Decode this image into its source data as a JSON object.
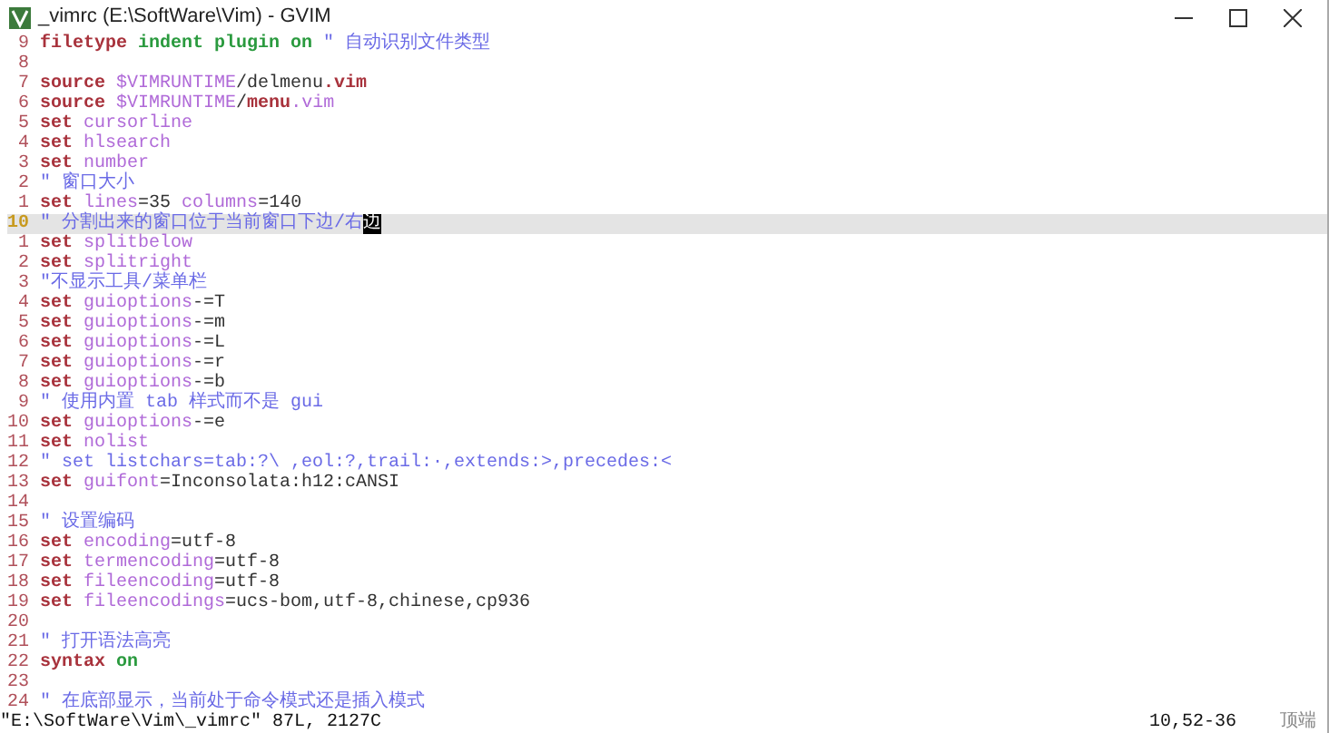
{
  "window": {
    "title": "_vimrc (E:\\SoftWare\\Vim) - GVIM"
  },
  "lines": [
    {
      "number": "9",
      "current": false,
      "tokens": [
        {
          "text": "filetype",
          "kind": "keyword"
        },
        {
          "text": " indent plugin on",
          "kind": "constant"
        },
        {
          "text": " \" 自动识别文件类型",
          "kind": "comment"
        }
      ]
    },
    {
      "number": "8",
      "current": false
    },
    {
      "number": "7",
      "current": false,
      "tokens": [
        {
          "text": "source",
          "kind": "keyword"
        },
        {
          "text": " $VIMRUNTIME",
          "kind": "option"
        },
        {
          "text": "/delmenu",
          "kind": "plain"
        },
        {
          "text": ".vim",
          "kind": "keyword"
        }
      ]
    },
    {
      "number": "6",
      "current": false,
      "tokens": [
        {
          "text": "source",
          "kind": "keyword"
        },
        {
          "text": " $VIMRUNTIME",
          "kind": "option"
        },
        {
          "text": "/",
          "kind": "plain"
        },
        {
          "text": "menu",
          "kind": "keyword"
        },
        {
          "text": ".vim",
          "kind": "option"
        }
      ]
    },
    {
      "number": "5",
      "current": false,
      "tokens": [
        {
          "text": "set",
          "kind": "keyword"
        },
        {
          "text": " cursorline",
          "kind": "option"
        }
      ]
    },
    {
      "number": "4",
      "current": false,
      "tokens": [
        {
          "text": "set",
          "kind": "keyword"
        },
        {
          "text": " hlsearch",
          "kind": "option"
        }
      ]
    },
    {
      "number": "3",
      "current": false,
      "tokens": [
        {
          "text": "set",
          "kind": "keyword"
        },
        {
          "text": " number",
          "kind": "option"
        }
      ]
    },
    {
      "number": "2",
      "current": false,
      "tokens": [
        {
          "text": "\" 窗口大小",
          "kind": "comment"
        }
      ]
    },
    {
      "number": "1",
      "current": false,
      "tokens": [
        {
          "text": "set",
          "kind": "keyword"
        },
        {
          "text": " lines",
          "kind": "option"
        },
        {
          "text": "=35",
          "kind": "plain"
        },
        {
          "text": " columns",
          "kind": "option"
        },
        {
          "text": "=140",
          "kind": "plain"
        }
      ]
    },
    {
      "number": "10",
      "current": true,
      "tokens": [
        {
          "text": "\" 分割出来的窗口位于当前窗口下边/右",
          "kind": "comment"
        },
        {
          "text": "边",
          "kind": "cursor"
        }
      ]
    },
    {
      "number": "1",
      "current": false,
      "tokens": [
        {
          "text": "set",
          "kind": "keyword"
        },
        {
          "text": " splitbelow",
          "kind": "option"
        }
      ]
    },
    {
      "number": "2",
      "current": false,
      "tokens": [
        {
          "text": "set",
          "kind": "keyword"
        },
        {
          "text": " splitright",
          "kind": "option"
        }
      ]
    },
    {
      "number": "3",
      "current": false,
      "tokens": [
        {
          "text": "\"不显示工具/菜单栏",
          "kind": "comment"
        }
      ]
    },
    {
      "number": "4",
      "current": false,
      "tokens": [
        {
          "text": "set",
          "kind": "keyword"
        },
        {
          "text": " guioptions",
          "kind": "option"
        },
        {
          "text": "-=T",
          "kind": "plain"
        }
      ]
    },
    {
      "number": "5",
      "current": false,
      "tokens": [
        {
          "text": "set",
          "kind": "keyword"
        },
        {
          "text": " guioptions",
          "kind": "option"
        },
        {
          "text": "-=m",
          "kind": "plain"
        }
      ]
    },
    {
      "number": "6",
      "current": false,
      "tokens": [
        {
          "text": "set",
          "kind": "keyword"
        },
        {
          "text": " guioptions",
          "kind": "option"
        },
        {
          "text": "-=L",
          "kind": "plain"
        }
      ]
    },
    {
      "number": "7",
      "current": false,
      "tokens": [
        {
          "text": "set",
          "kind": "keyword"
        },
        {
          "text": " guioptions",
          "kind": "option"
        },
        {
          "text": "-=r",
          "kind": "plain"
        }
      ]
    },
    {
      "number": "8",
      "current": false,
      "tokens": [
        {
          "text": "set",
          "kind": "keyword"
        },
        {
          "text": " guioptions",
          "kind": "option"
        },
        {
          "text": "-=b",
          "kind": "plain"
        }
      ]
    },
    {
      "number": "9",
      "current": false,
      "tokens": [
        {
          "text": "\" 使用内置 tab 样式而不是 gui",
          "kind": "comment"
        }
      ]
    },
    {
      "number": "10",
      "current": false,
      "tokens": [
        {
          "text": "set",
          "kind": "keyword"
        },
        {
          "text": " guioptions",
          "kind": "option"
        },
        {
          "text": "-=e",
          "kind": "plain"
        }
      ]
    },
    {
      "number": "11",
      "current": false,
      "tokens": [
        {
          "text": "set",
          "kind": "keyword"
        },
        {
          "text": " nolist",
          "kind": "option"
        }
      ]
    },
    {
      "number": "12",
      "current": false,
      "tokens": [
        {
          "text": "\" set listchars=tab:?\\ ,eol:?,trail:·,extends:>,precedes:<",
          "kind": "comment"
        }
      ]
    },
    {
      "number": "13",
      "current": false,
      "tokens": [
        {
          "text": "set",
          "kind": "keyword"
        },
        {
          "text": " guifont",
          "kind": "option"
        },
        {
          "text": "=Inconsolata:h12:cANSI",
          "kind": "plain"
        }
      ]
    },
    {
      "number": "14",
      "current": false
    },
    {
      "number": "15",
      "current": false,
      "tokens": [
        {
          "text": "\" 设置编码",
          "kind": "comment"
        }
      ]
    },
    {
      "number": "16",
      "current": false,
      "tokens": [
        {
          "text": "set",
          "kind": "keyword"
        },
        {
          "text": " encoding",
          "kind": "option"
        },
        {
          "text": "=utf-8",
          "kind": "plain"
        }
      ]
    },
    {
      "number": "17",
      "current": false,
      "tokens": [
        {
          "text": "set",
          "kind": "keyword"
        },
        {
          "text": " termencoding",
          "kind": "option"
        },
        {
          "text": "=utf-8",
          "kind": "plain"
        }
      ]
    },
    {
      "number": "18",
      "current": false,
      "tokens": [
        {
          "text": "set",
          "kind": "keyword"
        },
        {
          "text": " fileencoding",
          "kind": "option"
        },
        {
          "text": "=utf-8",
          "kind": "plain"
        }
      ]
    },
    {
      "number": "19",
      "current": false,
      "tokens": [
        {
          "text": "set",
          "kind": "keyword"
        },
        {
          "text": " fileencodings",
          "kind": "option"
        },
        {
          "text": "=ucs-bom,utf-8,chinese,cp936",
          "kind": "plain"
        }
      ]
    },
    {
      "number": "20",
      "current": false
    },
    {
      "number": "21",
      "current": false,
      "tokens": [
        {
          "text": "\" 打开语法高亮",
          "kind": "comment"
        }
      ]
    },
    {
      "number": "22",
      "current": false,
      "tokens": [
        {
          "text": "syntax",
          "kind": "keyword"
        },
        {
          "text": " on",
          "kind": "constant"
        }
      ]
    },
    {
      "number": "23",
      "current": false
    },
    {
      "number": "24",
      "current": false,
      "tokens": [
        {
          "text": "\" 在底部显示，当前处于命令模式还是插入模式",
          "kind": "comment"
        }
      ]
    }
  ],
  "status_bar": {
    "message": "\"E:\\SoftWare\\Vim\\_vimrc\" 87L, 2127C",
    "position": "10,52-36",
    "scroll": "顶端"
  }
}
